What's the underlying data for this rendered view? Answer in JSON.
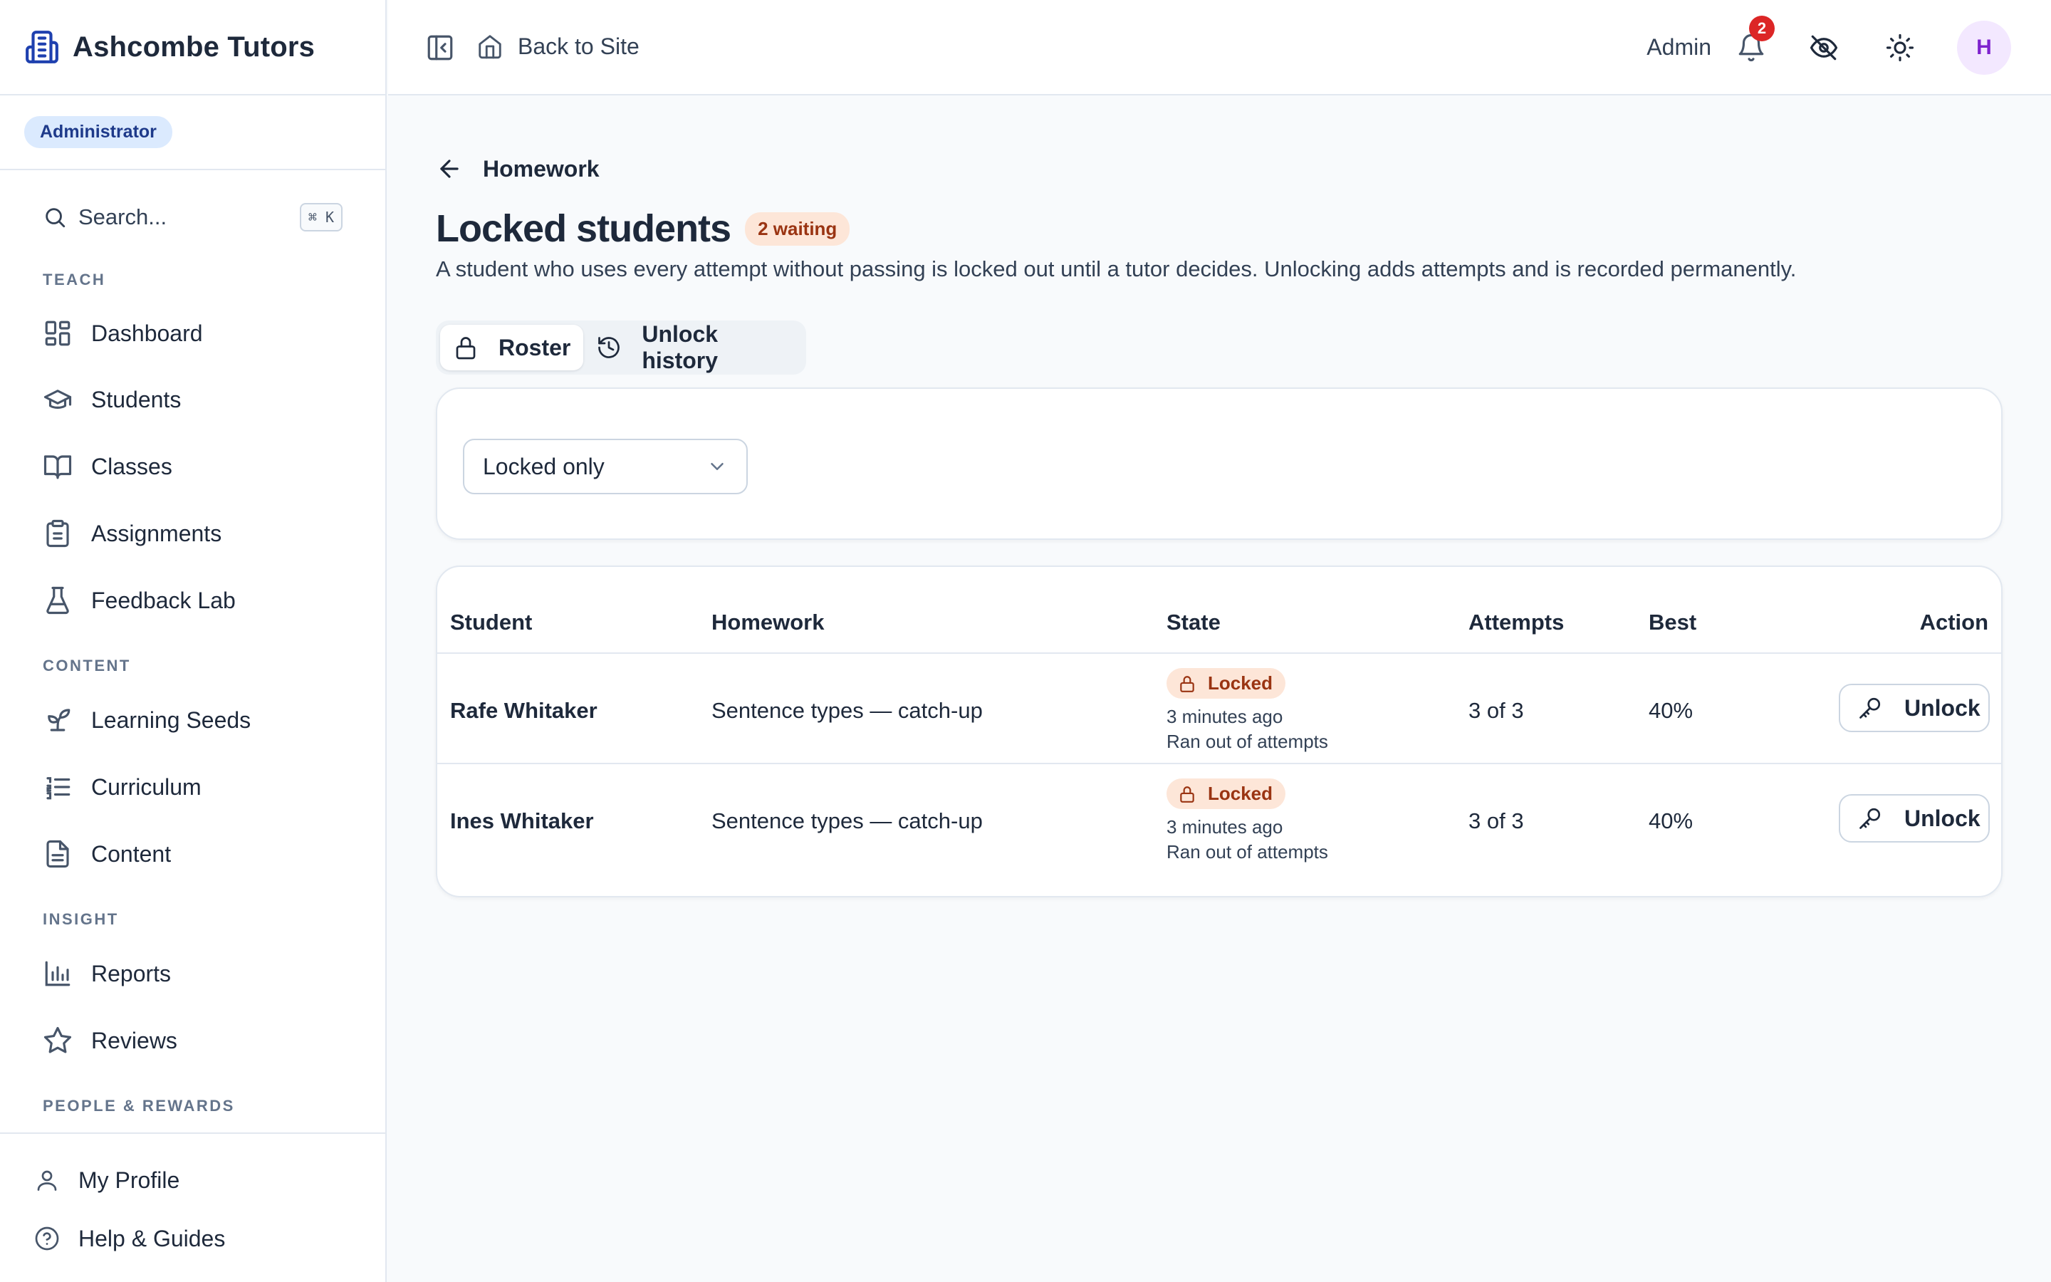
{
  "brand": {
    "name": "Ashcombe Tutors",
    "role": "Administrator"
  },
  "sidebar": {
    "search_placeholder": "Search...",
    "search_shortcut": "⌘ K",
    "sections": [
      {
        "label": "TEACH",
        "items": [
          {
            "label": "Dashboard",
            "icon": "dashboard-icon"
          },
          {
            "label": "Students",
            "icon": "graduation-cap-icon"
          },
          {
            "label": "Classes",
            "icon": "book-open-icon"
          },
          {
            "label": "Assignments",
            "icon": "clipboard-icon"
          },
          {
            "label": "Feedback Lab",
            "icon": "flask-icon"
          }
        ]
      },
      {
        "label": "CONTENT",
        "items": [
          {
            "label": "Learning Seeds",
            "icon": "sprout-icon"
          },
          {
            "label": "Curriculum",
            "icon": "list-ordered-icon"
          },
          {
            "label": "Content",
            "icon": "file-text-icon"
          }
        ]
      },
      {
        "label": "INSIGHT",
        "items": [
          {
            "label": "Reports",
            "icon": "bar-chart-icon"
          },
          {
            "label": "Reviews",
            "icon": "star-icon"
          }
        ]
      },
      {
        "label": "PEOPLE & REWARDS",
        "items": []
      }
    ],
    "bottom": [
      {
        "label": "My Profile",
        "icon": "user-icon"
      },
      {
        "label": "Help & Guides",
        "icon": "help-circle-icon"
      }
    ]
  },
  "topbar": {
    "back_label": "Back to Site",
    "admin_label": "Admin",
    "notification_count": "2",
    "avatar_initial": "H"
  },
  "page": {
    "breadcrumb": "Homework",
    "title": "Locked students",
    "waiting_badge": "2 waiting",
    "description": "A student who uses every attempt without passing is locked out until a tutor decides. Unlocking adds attempts and is recorded permanently."
  },
  "tabs": [
    {
      "label": "Roster",
      "icon": "lock-icon",
      "active": true
    },
    {
      "label": "Unlock history",
      "icon": "history-icon",
      "active": false
    }
  ],
  "filter": {
    "value": "Locked only"
  },
  "table": {
    "columns": [
      "Student",
      "Homework",
      "State",
      "Attempts",
      "Best",
      "Action"
    ],
    "rows": [
      {
        "student": "Rafe Whitaker",
        "homework": "Sentence types — catch-up",
        "state": "Locked",
        "state_time": "3 minutes ago",
        "state_reason": "Ran out of attempts",
        "attempts": "3 of 3",
        "best": "40%",
        "action": "Unlock"
      },
      {
        "student": "Ines Whitaker",
        "homework": "Sentence types — catch-up",
        "state": "Locked",
        "state_time": "3 minutes ago",
        "state_reason": "Ran out of attempts",
        "attempts": "3 of 3",
        "best": "40%",
        "action": "Unlock"
      }
    ]
  },
  "colors": {
    "accent_blue": "#1e40af",
    "badge_peach": "#fde6d8",
    "badge_text": "#9a3412",
    "notification_red": "#dc2626",
    "avatar_bg": "#f3e8ff",
    "avatar_text": "#7e22ce"
  }
}
